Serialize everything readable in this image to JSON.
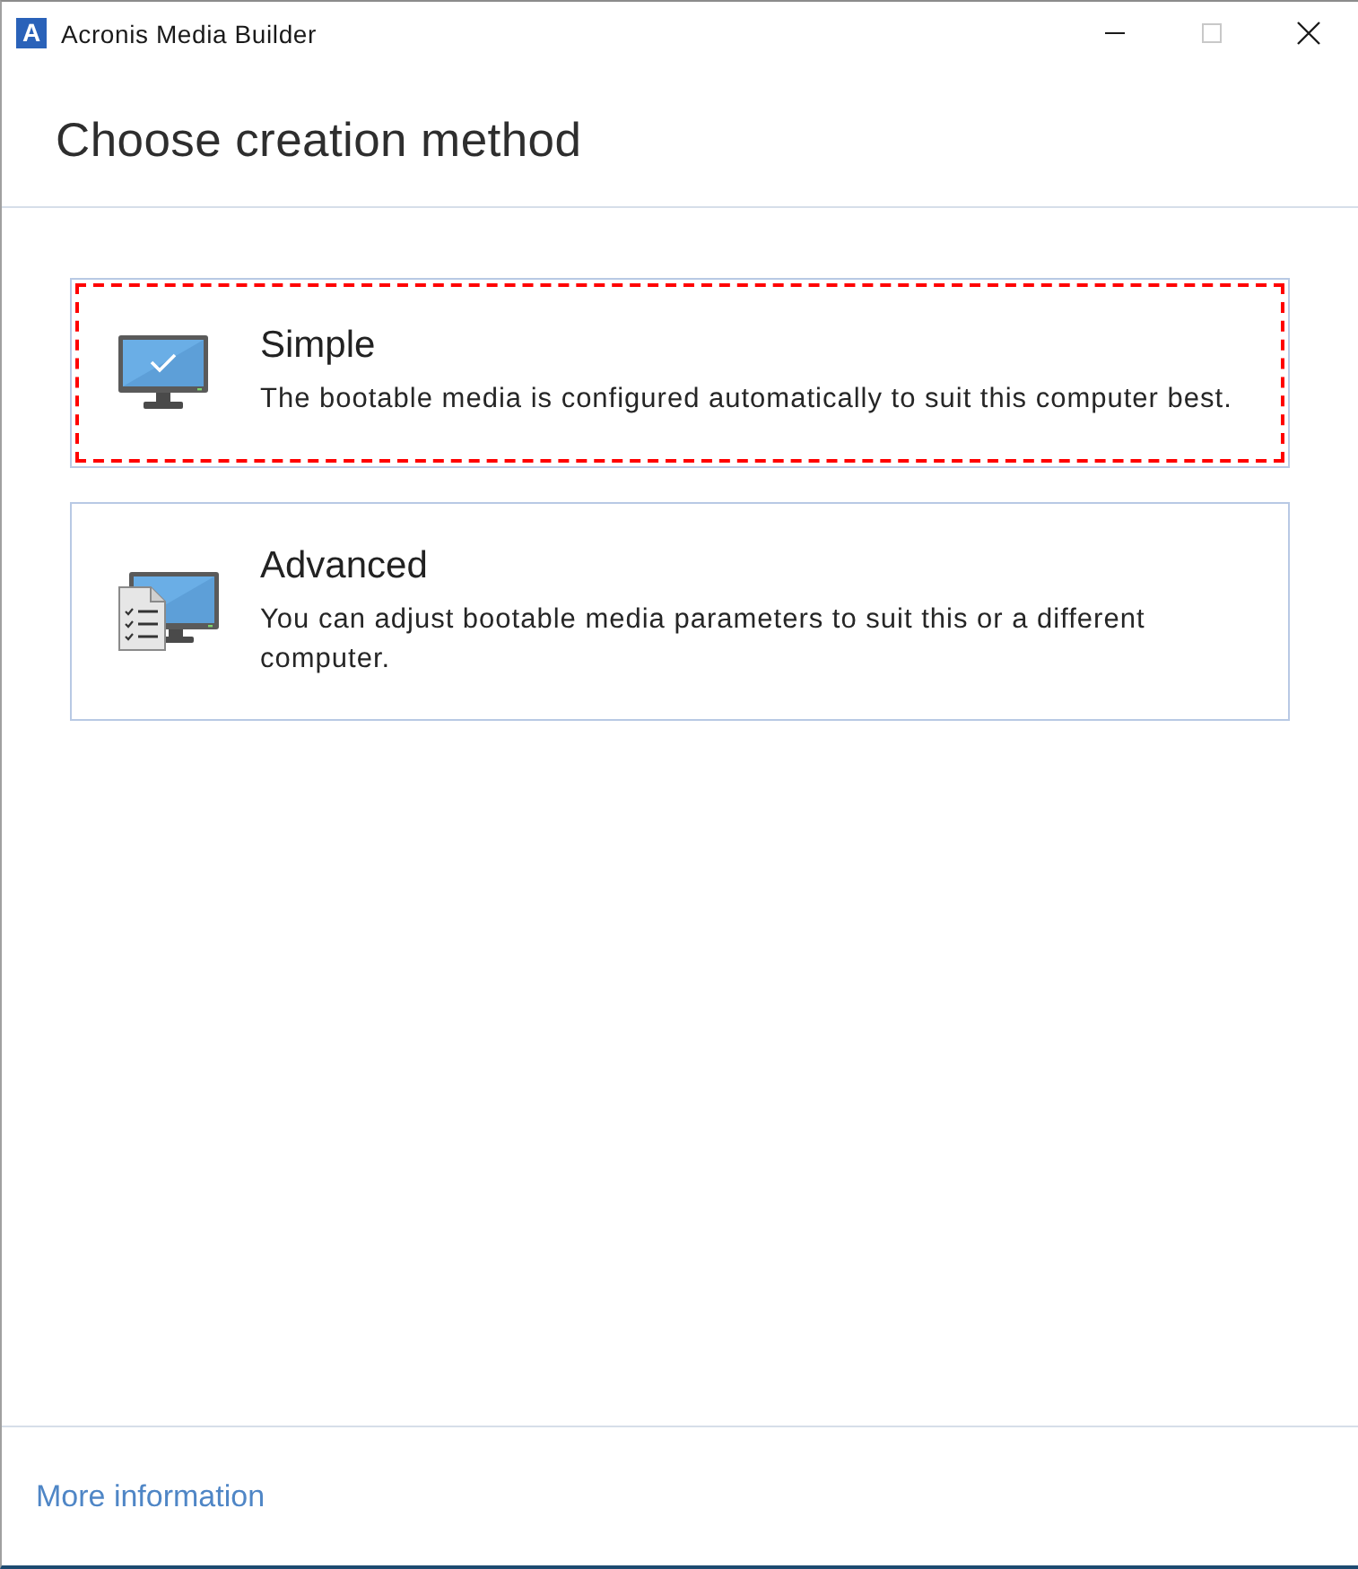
{
  "window": {
    "logo": "A",
    "title": "Acronis Media Builder",
    "controls": [
      {
        "kind": "minimize",
        "disabled": false
      },
      {
        "kind": "maximize",
        "disabled": true
      },
      {
        "kind": "close",
        "disabled": false
      }
    ]
  },
  "heading": "Choose creation method",
  "options": [
    {
      "kind": "simple",
      "title": "Simple",
      "description": "The bootable media is configured automatically to suit this computer best.",
      "highlighted": true
    },
    {
      "kind": "advanced",
      "title": "Advanced",
      "description": "You can adjust bootable media parameters to suit this or a different computer.",
      "highlighted": false
    }
  ],
  "footer": {
    "link": "More information"
  }
}
